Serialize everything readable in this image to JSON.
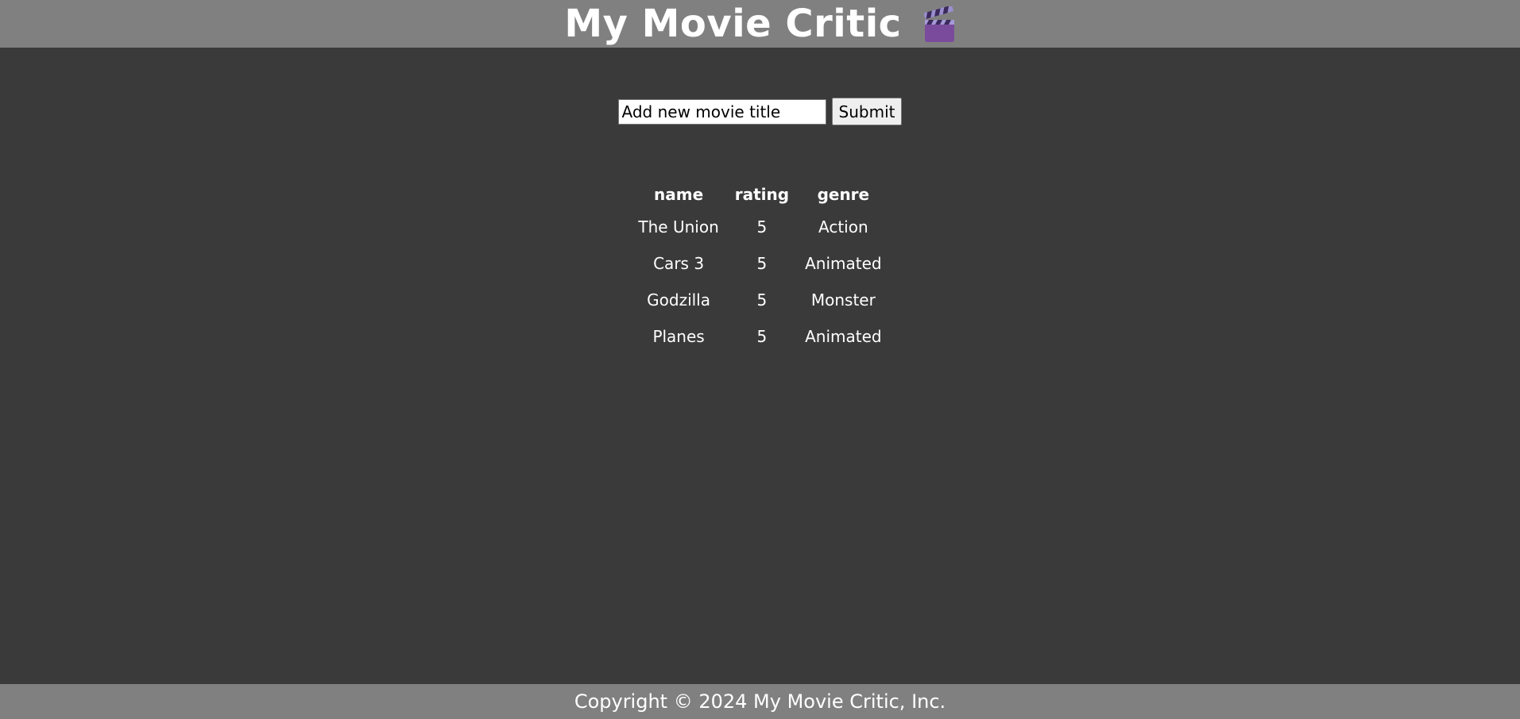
{
  "header": {
    "title": "My Movie Critic",
    "icon": "clapperboard-icon"
  },
  "form": {
    "input_placeholder": "Add new movie title",
    "submit_label": "Submit"
  },
  "table": {
    "headers": [
      "name",
      "rating",
      "genre"
    ],
    "rows": [
      [
        "The Union",
        "5",
        "Action"
      ],
      [
        "Cars 3",
        "5",
        "Animated"
      ],
      [
        "Godzilla",
        "5",
        "Monster"
      ],
      [
        "Planes",
        "5",
        "Animated"
      ]
    ]
  },
  "footer": {
    "text": "Copyright © 2024 My Movie Critic, Inc."
  },
  "colors": {
    "background": "#3a3a3a",
    "bar": "#808080",
    "clapper_purple": "#7d4a9c"
  }
}
